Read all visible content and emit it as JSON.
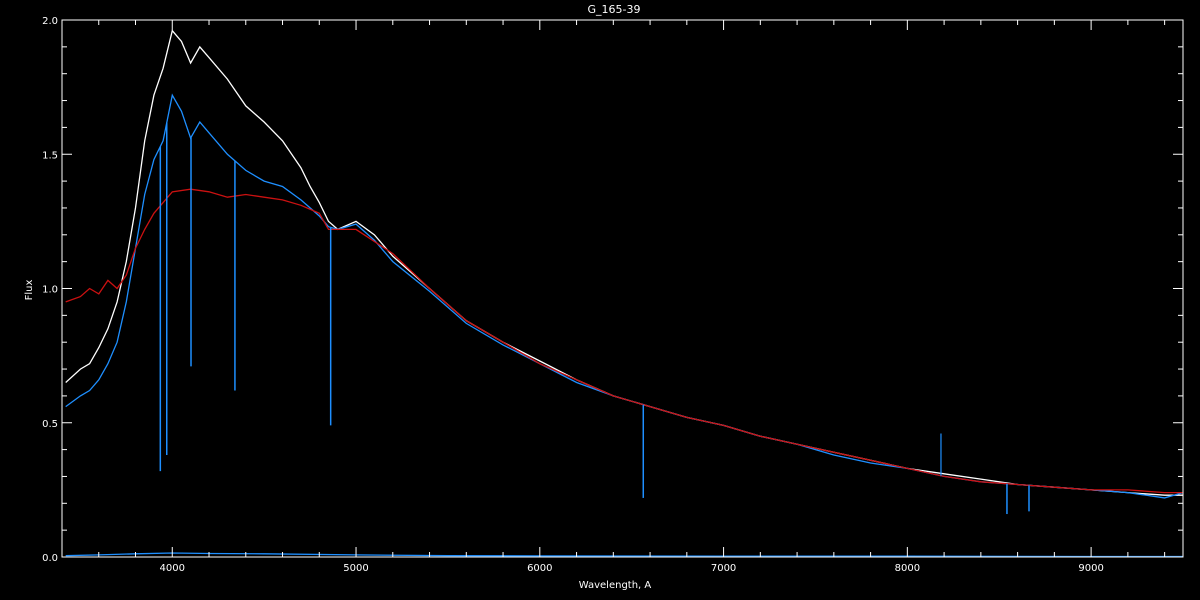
{
  "chart_data": {
    "type": "line",
    "title": "G_165-39",
    "xlabel": "Wavelength, A",
    "ylabel": "Flux",
    "xlim": [
      3400,
      9500
    ],
    "ylim": [
      0,
      2.0
    ],
    "x_ticks": [
      4000,
      5000,
      6000,
      7000,
      8000,
      9000
    ],
    "x_tick_labels": [
      "4000",
      "5000",
      "6000",
      "7000",
      "8000",
      "9000"
    ],
    "y_ticks": [
      0.0,
      0.5,
      1.0,
      1.5,
      2.0
    ],
    "y_tick_labels": [
      "0.0",
      "0.5",
      "1.0",
      "1.5",
      "2.0"
    ],
    "x_minor_step": 200,
    "y_minor_step": 0.1,
    "grid": false,
    "legend": "none",
    "background": "#000000",
    "axis_color": "#ffffff",
    "series": [
      {
        "color": "#ffffff",
        "x": [
          3420,
          3500,
          3550,
          3600,
          3650,
          3700,
          3750,
          3800,
          3850,
          3900,
          3950,
          4000,
          4050,
          4100,
          4150,
          4200,
          4300,
          4400,
          4500,
          4600,
          4700,
          4750,
          4800,
          4850,
          4900,
          5000,
          5100,
          5200,
          5400,
          5600,
          5800,
          6000,
          6200,
          6400,
          6600,
          6800,
          7000,
          7200,
          7400,
          7600,
          7800,
          8000,
          8200,
          8400,
          8600,
          8800,
          9000,
          9200,
          9400,
          9500
        ],
        "y": [
          0.65,
          0.7,
          0.72,
          0.78,
          0.85,
          0.95,
          1.1,
          1.3,
          1.55,
          1.72,
          1.82,
          1.96,
          1.92,
          1.84,
          1.9,
          1.86,
          1.78,
          1.68,
          1.62,
          1.55,
          1.45,
          1.38,
          1.32,
          1.25,
          1.22,
          1.25,
          1.2,
          1.12,
          1.0,
          0.88,
          0.8,
          0.73,
          0.66,
          0.6,
          0.56,
          0.52,
          0.49,
          0.45,
          0.42,
          0.39,
          0.36,
          0.33,
          0.31,
          0.29,
          0.27,
          0.26,
          0.25,
          0.24,
          0.23,
          0.23
        ]
      },
      {
        "color": "#1e8fff",
        "x": [
          3420,
          3500,
          3550,
          3600,
          3650,
          3700,
          3750,
          3800,
          3850,
          3900,
          3950,
          4000,
          4050,
          4100,
          4150,
          4200,
          4300,
          4400,
          4500,
          4600,
          4700,
          4750,
          4800,
          4850,
          4900,
          5000,
          5100,
          5200,
          5400,
          5600,
          5800,
          6000,
          6200,
          6400,
          6600,
          6800,
          7000,
          7200,
          7400,
          7600,
          7800,
          8000,
          8200,
          8400,
          8600,
          8800,
          9000,
          9200,
          9400,
          9500
        ],
        "y": [
          0.56,
          0.6,
          0.62,
          0.66,
          0.72,
          0.8,
          0.95,
          1.15,
          1.35,
          1.48,
          1.55,
          1.72,
          1.66,
          1.56,
          1.62,
          1.58,
          1.5,
          1.44,
          1.4,
          1.38,
          1.33,
          1.3,
          1.27,
          1.23,
          1.22,
          1.24,
          1.18,
          1.1,
          0.99,
          0.87,
          0.79,
          0.72,
          0.65,
          0.6,
          0.56,
          0.52,
          0.49,
          0.45,
          0.42,
          0.38,
          0.35,
          0.33,
          0.3,
          0.28,
          0.27,
          0.26,
          0.25,
          0.24,
          0.22,
          0.24
        ]
      },
      {
        "color": "#cc1111",
        "x": [
          3420,
          3500,
          3550,
          3600,
          3650,
          3700,
          3750,
          3800,
          3850,
          3900,
          3950,
          4000,
          4100,
          4200,
          4300,
          4400,
          4500,
          4600,
          4700,
          4800,
          4850,
          4900,
          5000,
          5200,
          5400,
          5600,
          5800,
          6000,
          6200,
          6400,
          6600,
          6800,
          7000,
          7200,
          7400,
          7600,
          7800,
          8000,
          8200,
          8400,
          8600,
          8800,
          9000,
          9200,
          9400,
          9500
        ],
        "y": [
          0.95,
          0.97,
          1.0,
          0.98,
          1.03,
          1.0,
          1.05,
          1.15,
          1.22,
          1.28,
          1.32,
          1.36,
          1.37,
          1.36,
          1.34,
          1.35,
          1.34,
          1.33,
          1.31,
          1.28,
          1.22,
          1.22,
          1.22,
          1.13,
          1.0,
          0.88,
          0.8,
          0.72,
          0.66,
          0.6,
          0.56,
          0.52,
          0.49,
          0.45,
          0.42,
          0.39,
          0.36,
          0.33,
          0.3,
          0.28,
          0.27,
          0.26,
          0.25,
          0.25,
          0.24,
          0.24
        ]
      },
      {
        "color": "#1e8fff",
        "x": [
          3420,
          3600,
          3800,
          4000,
          4200,
          4500,
          5000,
          5500,
          6000,
          7000,
          8000,
          9000,
          9500
        ],
        "y": [
          0.005,
          0.008,
          0.012,
          0.015,
          0.013,
          0.012,
          0.008,
          0.005,
          0.004,
          0.003,
          0.003,
          0.002,
          0.002
        ]
      }
    ],
    "absorption_lines": [
      {
        "x": 3935,
        "y_min": 0.32
      },
      {
        "x": 3970,
        "y_min": 0.38
      },
      {
        "x": 4102,
        "y_min": 0.71
      },
      {
        "x": 4341,
        "y_min": 0.62
      },
      {
        "x": 4862,
        "y_min": 0.49
      },
      {
        "x": 6563,
        "y_min": 0.22
      },
      {
        "x": 8542,
        "y_min": 0.16
      },
      {
        "x": 8662,
        "y_min": 0.17
      }
    ],
    "emission_spikes": [
      {
        "x": 8183,
        "y_max": 0.46
      }
    ]
  }
}
